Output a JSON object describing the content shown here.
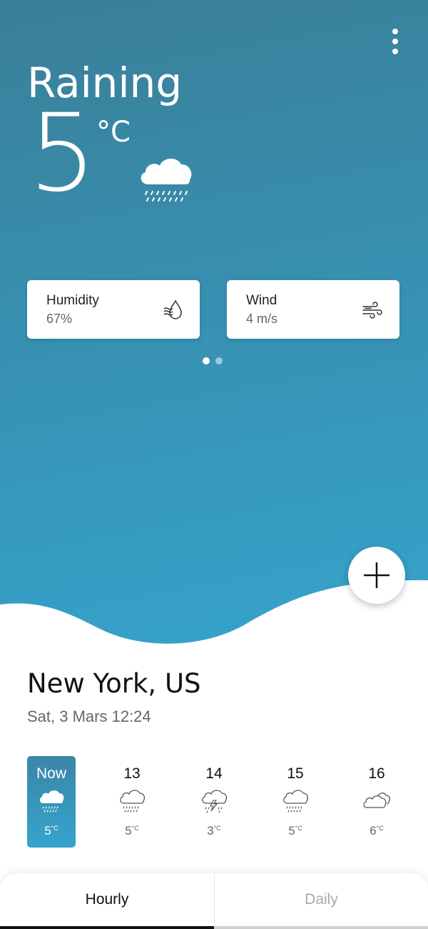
{
  "current": {
    "condition": "Raining",
    "temperature": "5",
    "unit": "°C",
    "icon": "rain-cloud-icon"
  },
  "cards": [
    {
      "title": "Humidity",
      "value": "67%",
      "icon": "humidity-drop-icon"
    },
    {
      "title": "Wind",
      "value": "4 m/s",
      "icon": "wind-icon"
    }
  ],
  "pager": {
    "count": 2,
    "active": 0
  },
  "location": {
    "city": "New York, US",
    "datetime": "Sat, 3 Mars 12:24"
  },
  "hourly": [
    {
      "label": "Now",
      "temp": "5",
      "unit": "°C",
      "icon": "rain-cloud-icon",
      "active": true
    },
    {
      "label": "13",
      "temp": "5",
      "unit": "°C",
      "icon": "rain-cloud-icon"
    },
    {
      "label": "14",
      "temp": "3",
      "unit": "°C",
      "icon": "thunderstorm-icon"
    },
    {
      "label": "15",
      "temp": "5",
      "unit": "°C",
      "icon": "rain-cloud-icon"
    },
    {
      "label": "16",
      "temp": "6",
      "unit": "°C",
      "icon": "cloudy-icon"
    }
  ],
  "tabs": {
    "hourly": "Hourly",
    "daily": "Daily",
    "active": "hourly"
  },
  "colors": {
    "gradient_top": "#3a7f97",
    "gradient_bottom": "#36a4cc",
    "accent_active": "#111111"
  }
}
